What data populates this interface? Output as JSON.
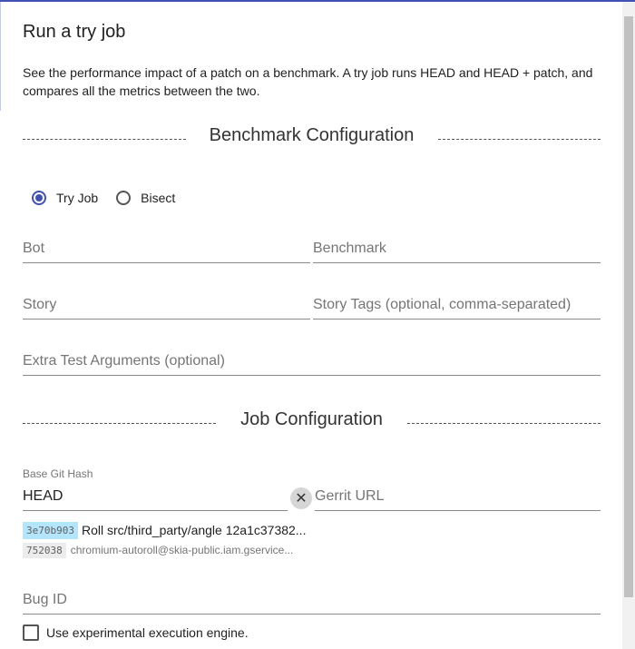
{
  "dialog": {
    "title": "Run a try job",
    "description": "See the performance impact of a patch on a benchmark. A try job runs HEAD and HEAD + patch, and compares all the metrics between the two."
  },
  "benchmark_section": {
    "title": "Benchmark Configuration",
    "mode_options": [
      {
        "label": "Try Job",
        "selected": true
      },
      {
        "label": "Bisect",
        "selected": false
      }
    ],
    "fields": {
      "bot_placeholder": "Bot",
      "benchmark_placeholder": "Benchmark",
      "story_placeholder": "Story",
      "story_tags_placeholder": "Story Tags (optional, comma-separated)",
      "extra_args_placeholder": "Extra Test Arguments (optional)"
    }
  },
  "job_section": {
    "title": "Job Configuration",
    "base_git_hash": {
      "label": "Base Git Hash",
      "value": "HEAD"
    },
    "gerrit_url_placeholder": "Gerrit URL",
    "commit": {
      "hash": "3e70b903",
      "subject": "Roll src/third_party/angle 12a1c37382...",
      "number": "752038",
      "author": "chromium-autoroll@skia-public.iam.gservice..."
    },
    "bug_id_placeholder": "Bug ID",
    "experimental_engine_label": "Use experimental execution engine."
  },
  "colors": {
    "accent": "#3f51b5",
    "hash_chip": "#b3e5fc"
  }
}
